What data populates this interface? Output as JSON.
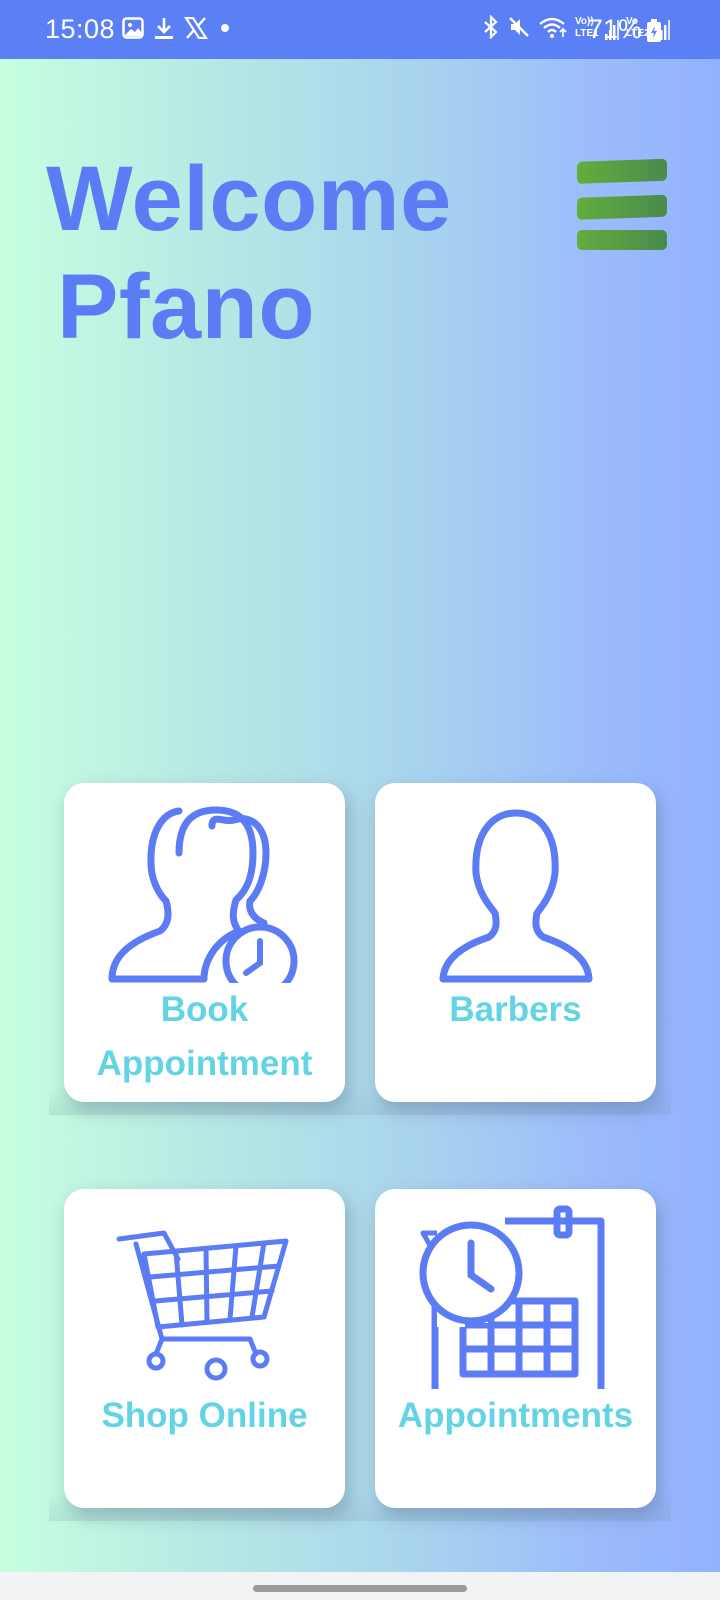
{
  "status_bar": {
    "time": "15:08",
    "battery": "71%",
    "left_icons": [
      "gallery-icon",
      "download-icon",
      "x-logo-icon",
      "dot-icon"
    ],
    "right_icons": [
      "bluetooth-icon",
      "mute-icon",
      "wifi-icon",
      "signal-sim1-icon",
      "signal-sim2-icon",
      "battery-icon"
    ],
    "sim1_label_top": "Vo))",
    "sim1_label_bottom": "LTE1",
    "sim2_label_top": "Vo",
    "sim2_label_bottom": "LTE2"
  },
  "header": {
    "welcome_line1": "Welcome",
    "welcome_line2": "Pfano",
    "menu_icon": "hamburger-menu-icon"
  },
  "tiles": [
    {
      "label_line1": "Book",
      "label_line2": "Appointment",
      "icon": "users-clock-icon"
    },
    {
      "label": "Barbers",
      "icon": "user-icon"
    },
    {
      "label": "Shop Online",
      "icon": "shopping-cart-icon"
    },
    {
      "label": "Appointments",
      "icon": "calendar-clock-icon"
    }
  ],
  "colors": {
    "accent": "#5b7cf4",
    "tile_label": "#63d4e4",
    "status_bar": "#5b7ff4",
    "menu_green": "#5fa83f"
  }
}
